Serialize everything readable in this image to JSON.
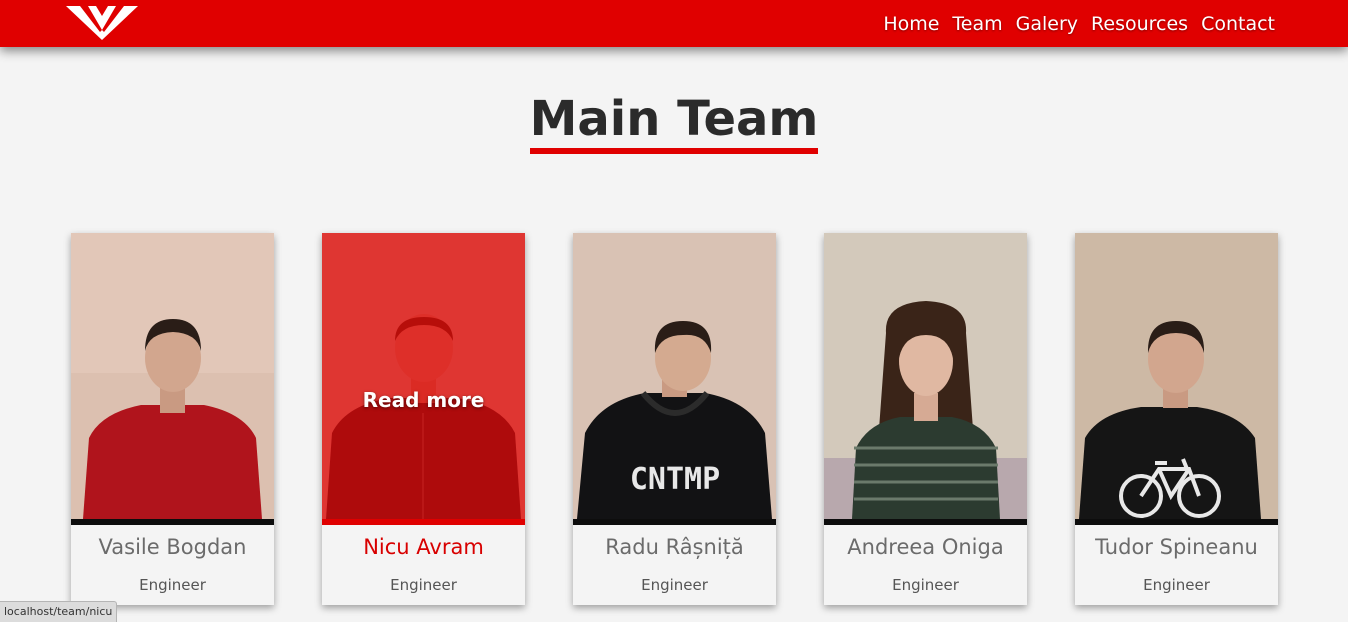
{
  "nav": {
    "logo_icon": "triangle-logo-icon",
    "links": [
      "Home",
      "Team",
      "Galery",
      "Resources",
      "Contact"
    ]
  },
  "section": {
    "title": "Main Team"
  },
  "team": [
    {
      "name": "Vasile Bogdan",
      "role": "Engineer",
      "shirt": "#b0141c",
      "bg": "#dcc0b0"
    },
    {
      "name": "Nicu Avram",
      "role": "Engineer",
      "shirt": "#2a2a2e",
      "bg": "#d8c0b4",
      "hover_label": "Read more"
    },
    {
      "name": "Radu Râșniță",
      "role": "Engineer",
      "shirt": "#121214",
      "bg": "#d9c2b4",
      "print": "CNTMP"
    },
    {
      "name": "Andreea Oniga",
      "role": "Engineer",
      "shirt": "#2c3b30",
      "bg": "#d3c9bb"
    },
    {
      "name": "Tudor Spineanu",
      "role": "Engineer",
      "shirt": "#151515",
      "bg": "#cdb9a5"
    }
  ],
  "status_bar": {
    "url": "localhost/team/nicu"
  },
  "colors": {
    "accent": "#e00000",
    "background": "#f4f4f4"
  }
}
